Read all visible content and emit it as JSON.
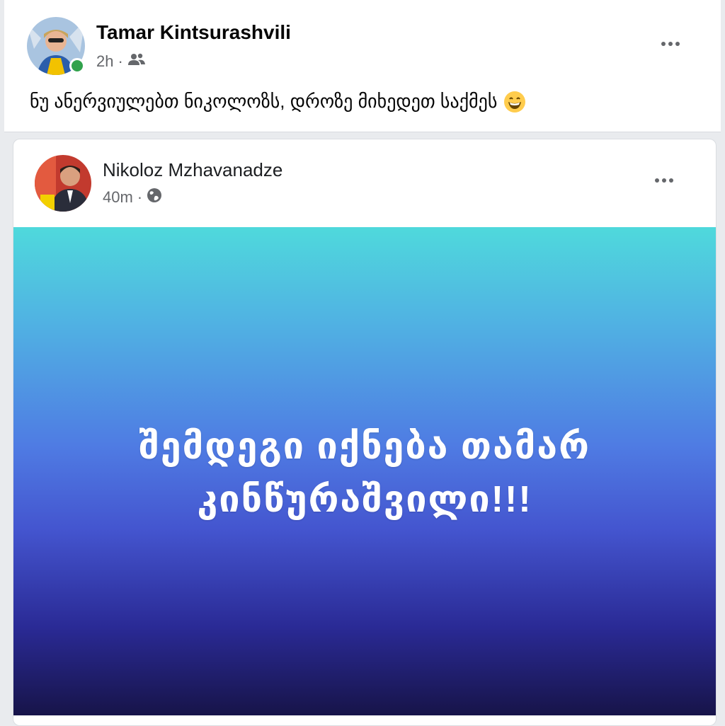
{
  "post": {
    "author": "Tamar Kintsurashvili",
    "time": "2h",
    "separator": "·",
    "audience_icon": "friends-icon",
    "text": "ნუ ანერვიულებთ ნიკოლოზს, დროზე მიხედეთ საქმეს",
    "emoji": "grinning-face-icon"
  },
  "shared_post": {
    "author": "Nikoloz Mzhavanadze",
    "time": "40m",
    "separator": "·",
    "audience_icon": "globe-icon",
    "banner_text": "შემდეგი იქნება თამარ კინწურაშვილი!!!"
  },
  "colors": {
    "online": "#31a24c",
    "banner_top": "#4fd9dc",
    "banner_bottom": "#171449"
  }
}
